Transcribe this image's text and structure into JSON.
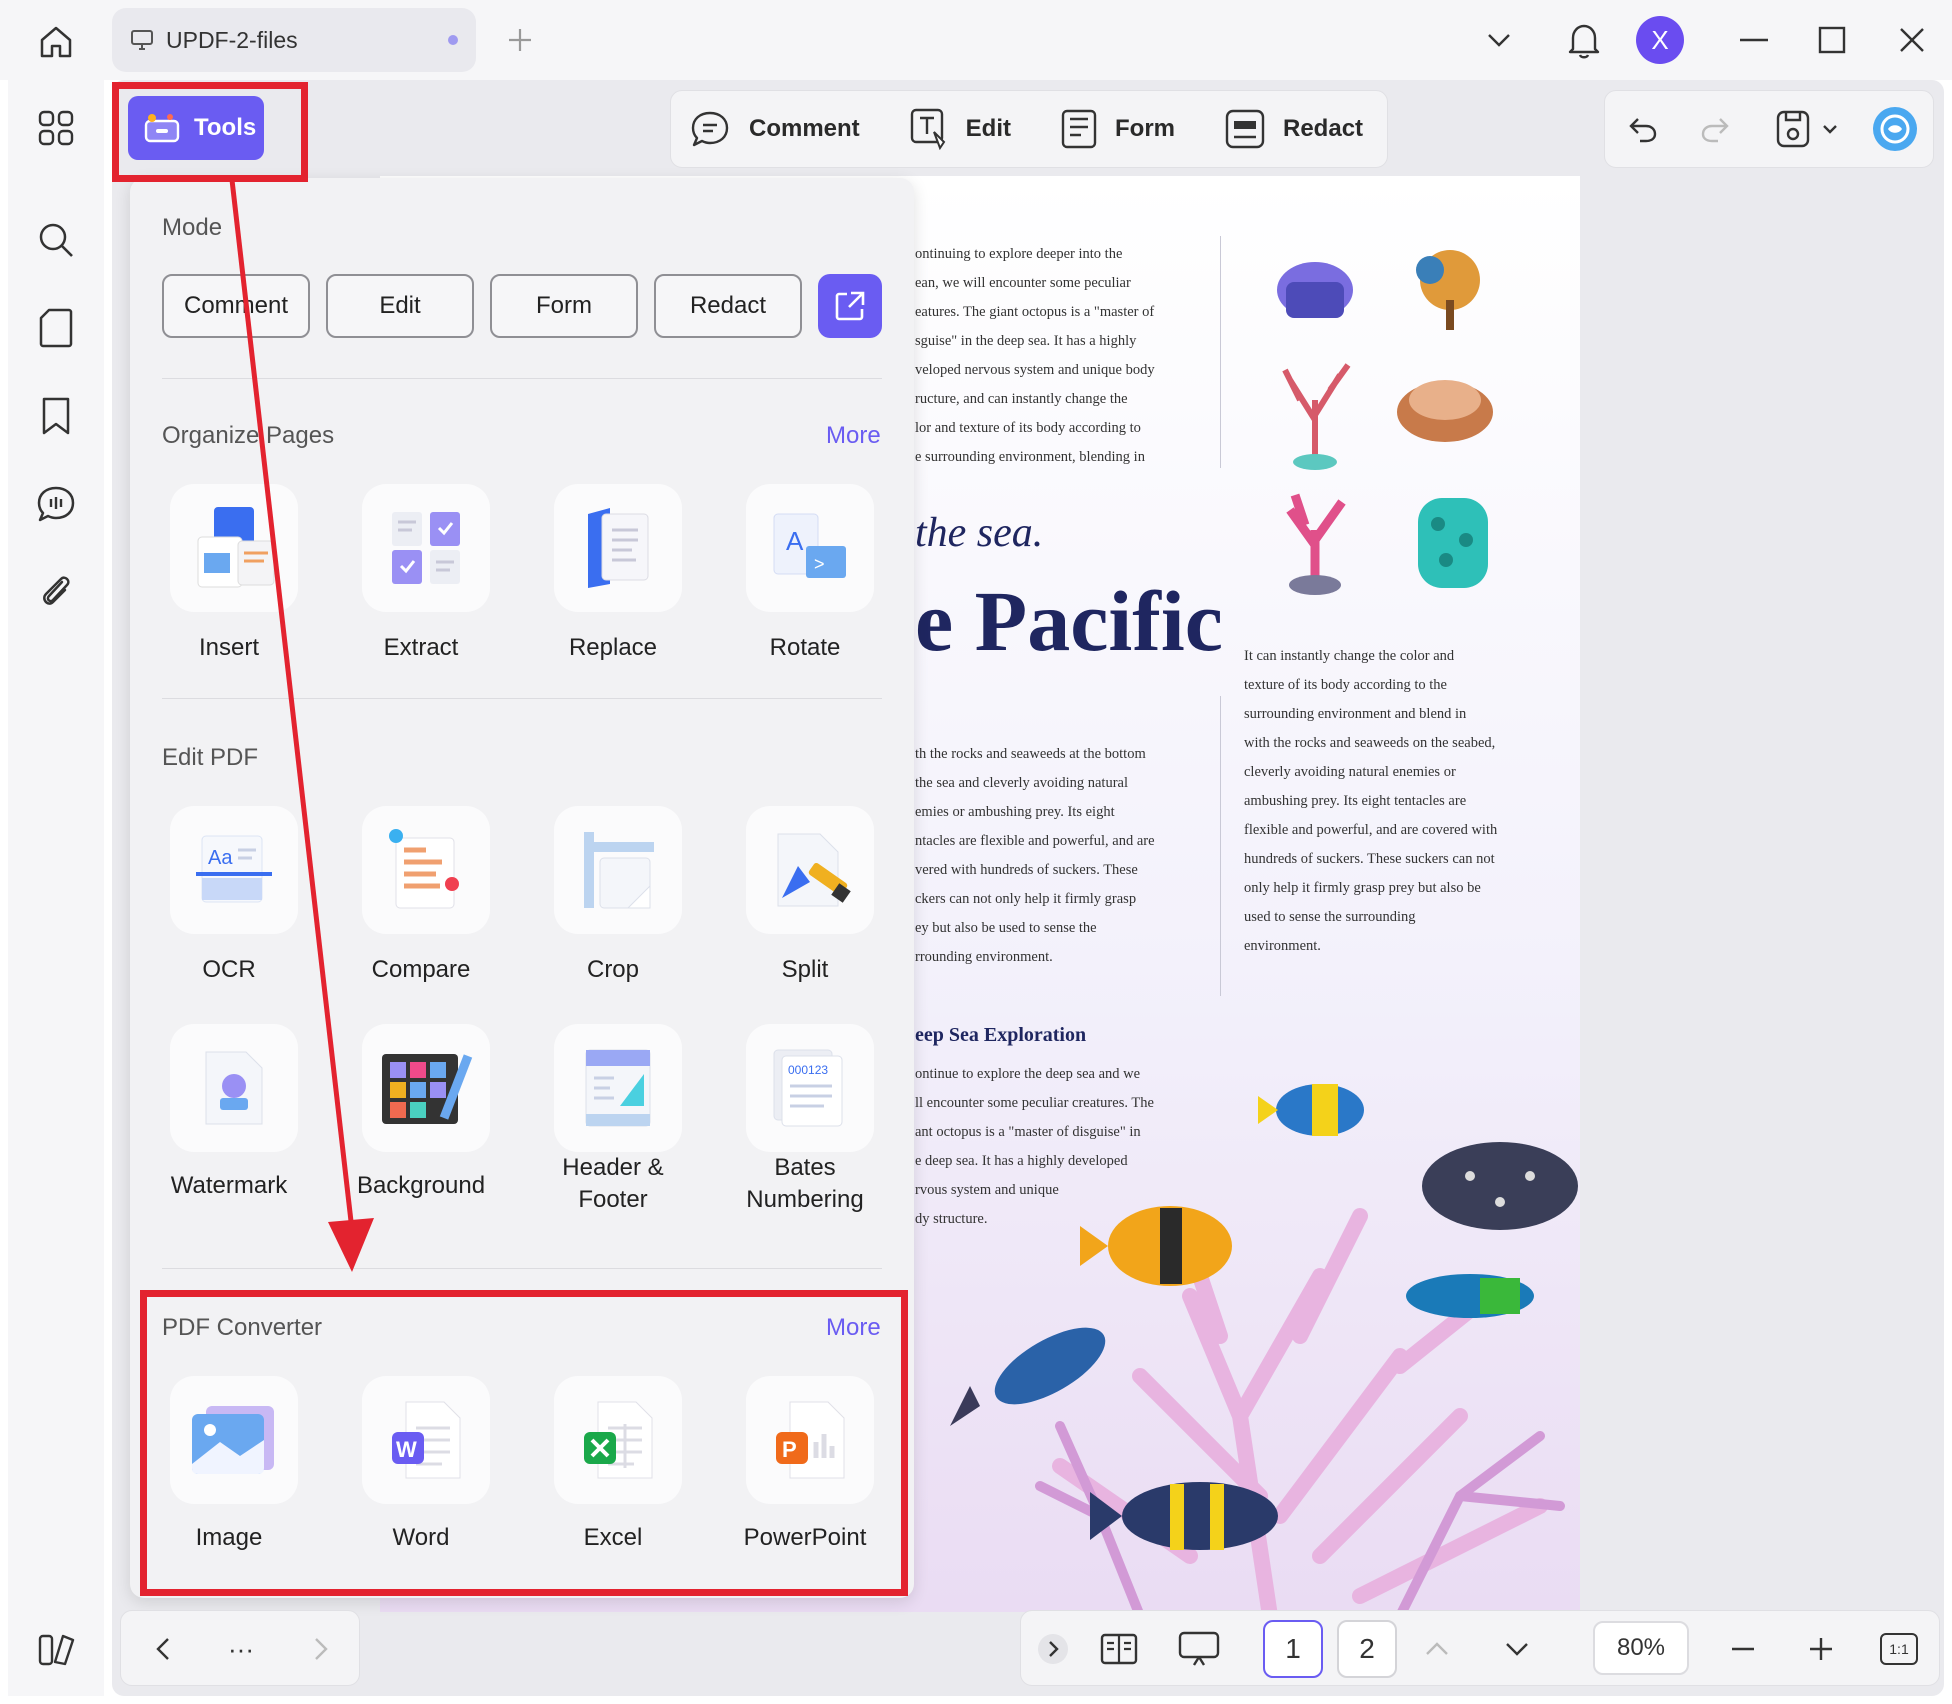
{
  "titlebar": {
    "tab_label": "UPDF-2-files",
    "avatar_letter": "X"
  },
  "main_toolbar": {
    "tools_label": "Tools",
    "comment_label": "Comment",
    "edit_label": "Edit",
    "form_label": "Form",
    "redact_label": "Redact"
  },
  "panel": {
    "mode_title": "Mode",
    "mode_buttons": [
      "Comment",
      "Edit",
      "Form",
      "Redact"
    ],
    "organize_title": "Organize Pages",
    "organize_more": "More",
    "organize_tools": [
      "Insert",
      "Extract",
      "Replace",
      "Rotate"
    ],
    "edit_title": "Edit PDF",
    "edit_tools": [
      "OCR",
      "Compare",
      "Crop",
      "Split",
      "Watermark",
      "Background",
      "Header & Footer",
      "Bates Numbering"
    ],
    "converter_title": "PDF Converter",
    "converter_more": "More",
    "converter_tools": [
      "Image",
      "Word",
      "Excel",
      "PowerPoint"
    ]
  },
  "pdf": {
    "col1": "ontinuing to explore deeper into the\nean, we will encounter some peculiar\neatures. The giant octopus is a \"master of\nsguise\" in the deep sea. It has a highly\nveloped nervous system and unique body\nructure, and can instantly change the\nlor and texture of its body according to\ne surrounding environment, blending in",
    "italic_text": "the sea.",
    "big_text": "e Pacific",
    "col2": "th the rocks and seaweeds at the bottom\n the sea and cleverly avoiding natural\nemies or ambushing prey. Its eight\nntacles are flexible and powerful, and are\nvered with hundreds of suckers. These\nckers can not only help it firmly grasp\ney but also be used to sense the\nrrounding environment.",
    "heading": "eep Sea Exploration",
    "col3": "ontinue to explore the deep sea and we\nll encounter some peculiar creatures. The\nant octopus is a \"master of disguise\" in\ne deep sea. It has a highly developed\nrvous system and unique\ndy structure.",
    "right_col": "It can instantly change the color and\ntexture of its body according to the\nsurrounding environment and blend in\nwith the rocks and seaweeds on the seabed,\ncleverly avoiding natural enemies or\nambushing prey. Its eight tentacles are\nflexible and powerful, and are covered with\nhundreds of suckers. These suckers can not\nonly help it firmly grasp prey but also be\nused to sense the surrounding\nenvironment."
  },
  "bottom_bar": {
    "ellipsis": "···",
    "page1": "1",
    "page2": "2",
    "zoom": "80%",
    "fit_label": "1:1"
  },
  "colors": {
    "accent": "#6a5cf2",
    "annotation_red": "#e3232f",
    "pdf_title": "#1f2660"
  }
}
